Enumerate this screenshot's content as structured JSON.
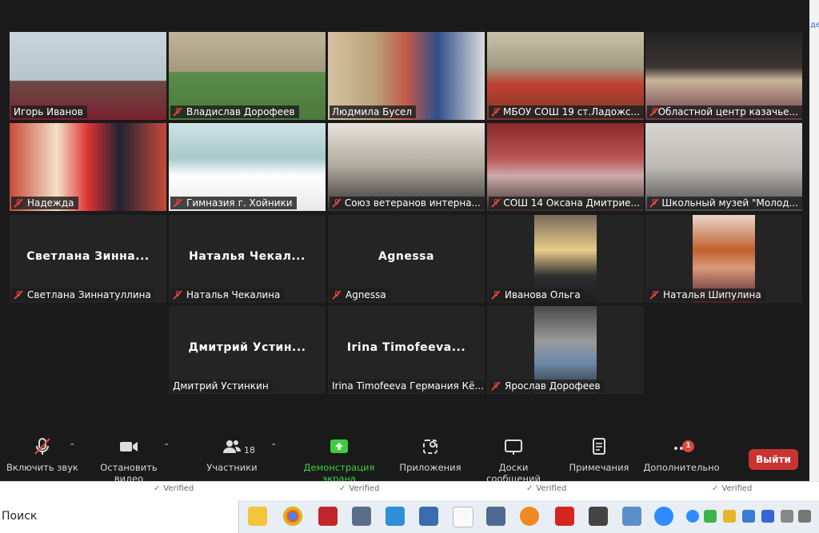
{
  "window": {
    "edge_text": "де"
  },
  "participants_grid": [
    {
      "name": "Игорь Иванов",
      "muted": false,
      "active": true,
      "row": 0,
      "col": 0,
      "video": true
    },
    {
      "name": "Владислав Дорофеев",
      "muted": true,
      "row": 0,
      "col": 1,
      "video": true
    },
    {
      "name": "Людмила Бусел",
      "muted": false,
      "row": 0,
      "col": 2,
      "video": true
    },
    {
      "name": "МБОУ СОШ 19 ст.Ладожс...",
      "muted": true,
      "row": 0,
      "col": 3,
      "video": true
    },
    {
      "name": "Областной центр казачье...",
      "muted": true,
      "row": 0,
      "col": 4,
      "video": true
    },
    {
      "name": "Надежда",
      "muted": true,
      "row": 1,
      "col": 0,
      "video": true
    },
    {
      "name": "Гимназия г. Хойники",
      "muted": true,
      "row": 1,
      "col": 1,
      "video": true
    },
    {
      "name": "Союз ветеранов интерна...",
      "muted": true,
      "row": 1,
      "col": 2,
      "video": true
    },
    {
      "name": "СОШ 14 Оксана Дмитрие...",
      "muted": true,
      "row": 1,
      "col": 3,
      "video": true
    },
    {
      "name": "Школьный музей \"Молод...",
      "muted": true,
      "row": 1,
      "col": 4,
      "video": true
    },
    {
      "name": "Светлана Зиннатуллина",
      "display": "Светлана  Зинна...",
      "muted": true,
      "row": 2,
      "col": 0,
      "video": false
    },
    {
      "name": "Наталья Чекалина",
      "display": "Наталья  Чекал...",
      "muted": true,
      "row": 2,
      "col": 1,
      "video": false
    },
    {
      "name": "Agnessa",
      "display": "Agnessa",
      "muted": true,
      "row": 2,
      "col": 2,
      "video": false
    },
    {
      "name": "Иванова Ольга",
      "muted": true,
      "row": 2,
      "col": 3,
      "video": false,
      "avatar": true
    },
    {
      "name": "Наталья Шипулина",
      "muted": true,
      "row": 2,
      "col": 4,
      "video": false,
      "avatar": true
    },
    {
      "name": "Дмитрий Устинкин",
      "display": "Дмитрий  Устин...",
      "muted": false,
      "row": 3,
      "col": 1,
      "video": false
    },
    {
      "name": "Irina Timofeeva Германия Кё...",
      "display": "Irina  Timofeeva...",
      "muted": false,
      "row": 3,
      "col": 2,
      "video": false
    },
    {
      "name": "Ярослав Дорофеев",
      "muted": true,
      "row": 3,
      "col": 3,
      "video": false,
      "avatar": true
    }
  ],
  "toolbar": {
    "unmute": "Включить звук",
    "stop_video": "Остановить видео",
    "participants": "Участники",
    "participants_count": "18",
    "share_screen": "Демонстрация экрана",
    "apps": "Приложения",
    "whiteboards": "Доски сообщений",
    "notes": "Примечания",
    "more": "Дополнительно",
    "more_badge": "1",
    "leave": "Выйти"
  },
  "background_strip": {
    "verified": [
      "Verified",
      "Verified",
      "Verified",
      "Verified"
    ]
  },
  "taskbar": {
    "search_placeholder": "Поиск"
  },
  "colors": {
    "share_green": "#3ccf3c",
    "leave_red": "#c93431",
    "active_border": "#c9d84a",
    "mute_red": "#e0453a"
  }
}
